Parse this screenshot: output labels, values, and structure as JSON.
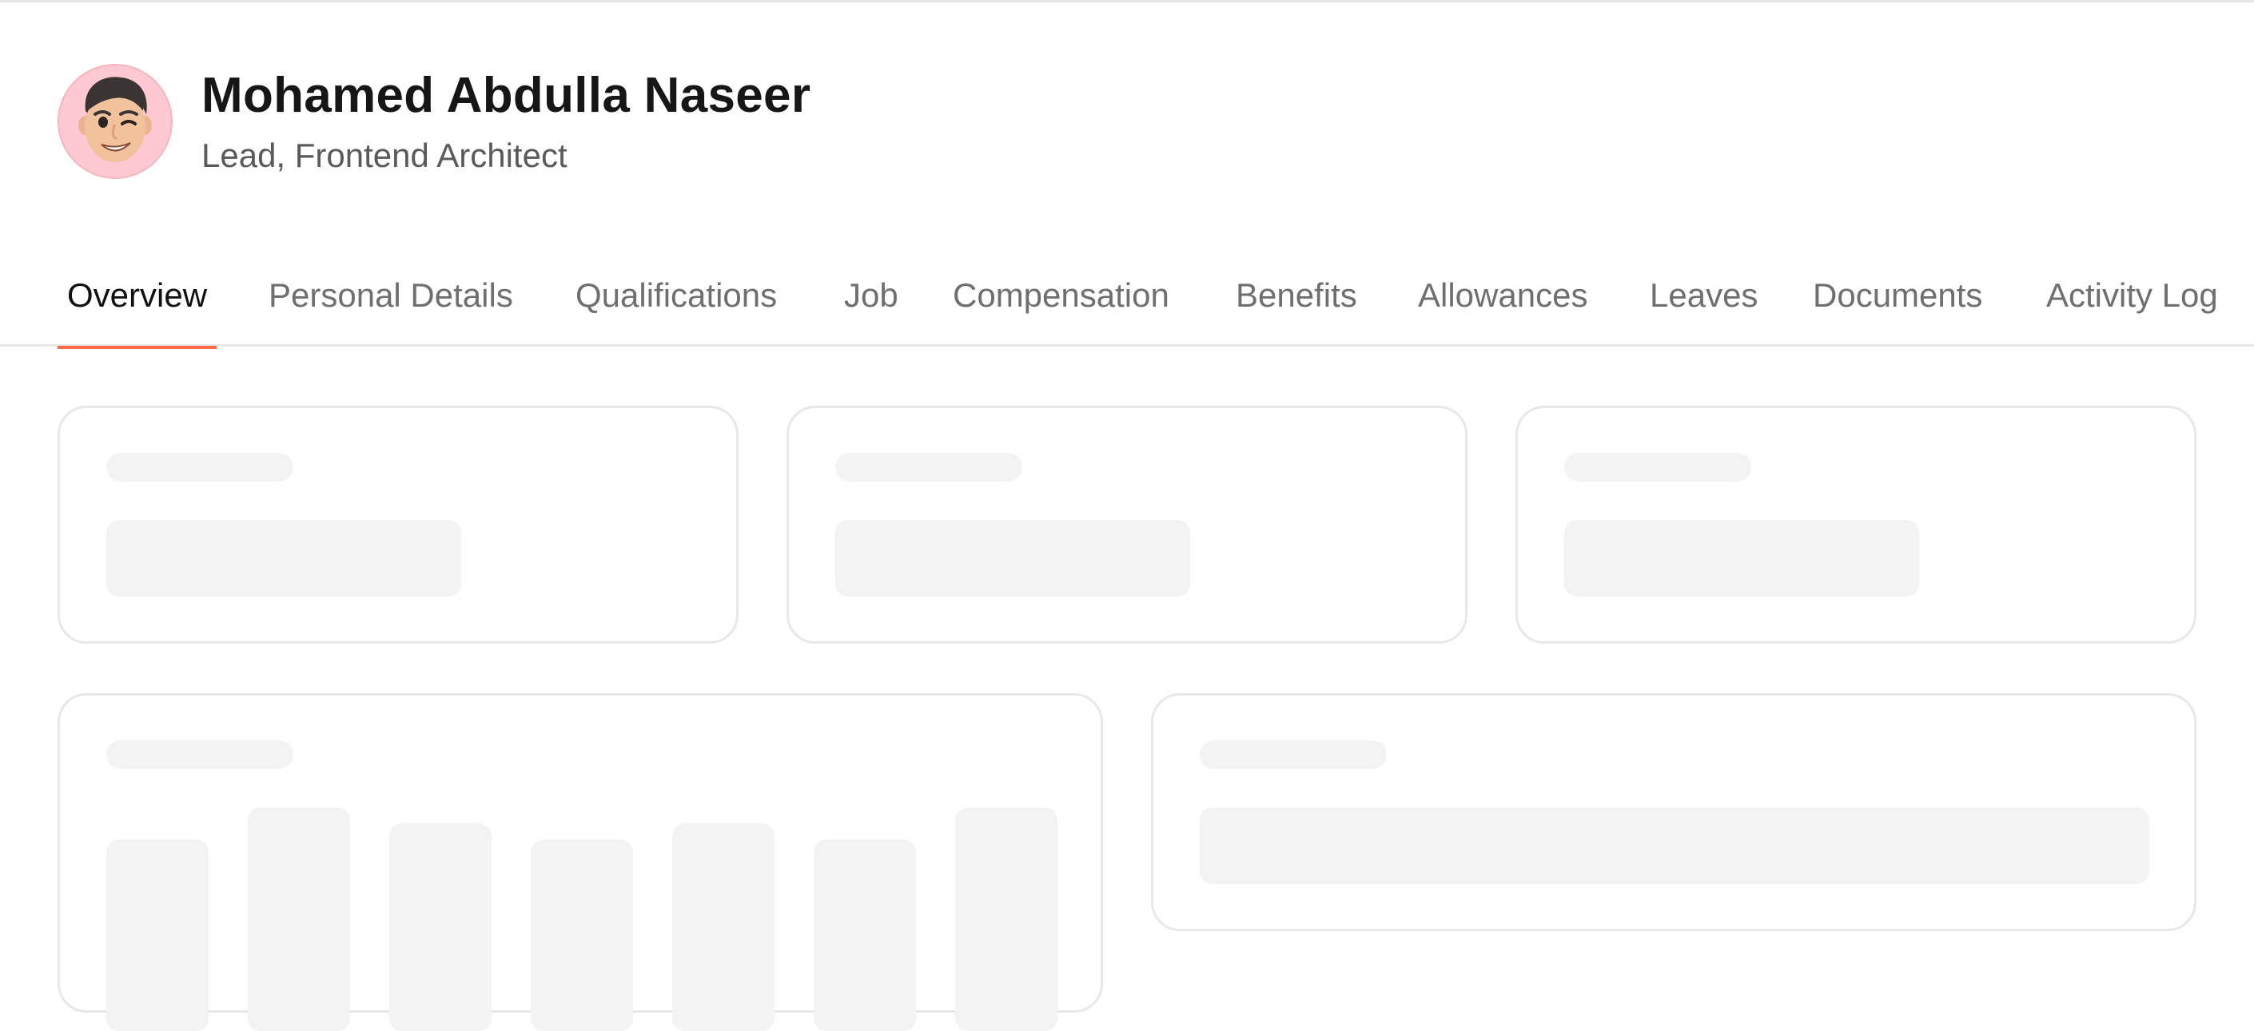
{
  "profile": {
    "name": "Mohamed Abdulla Naseer",
    "role": "Lead, Frontend Architect",
    "avatar_icon": "memoji-avatar-icon"
  },
  "tabs": [
    {
      "label": "Overview",
      "active": true
    },
    {
      "label": "Personal Details",
      "active": false
    },
    {
      "label": "Qualifications",
      "active": false
    },
    {
      "label": "Job",
      "active": false
    },
    {
      "label": "Compensation",
      "active": false
    },
    {
      "label": "Benefits",
      "active": false
    },
    {
      "label": "Allowances",
      "active": false
    },
    {
      "label": "Leaves",
      "active": false
    },
    {
      "label": "Documents",
      "active": false
    },
    {
      "label": "Activity Log",
      "active": false
    }
  ],
  "colors": {
    "accent": "#ff6b4a",
    "avatar_bg": "#ffc9d2",
    "skeleton": "#f3f3f3",
    "border": "#e8e8e8"
  },
  "state": "loading-skeleton"
}
